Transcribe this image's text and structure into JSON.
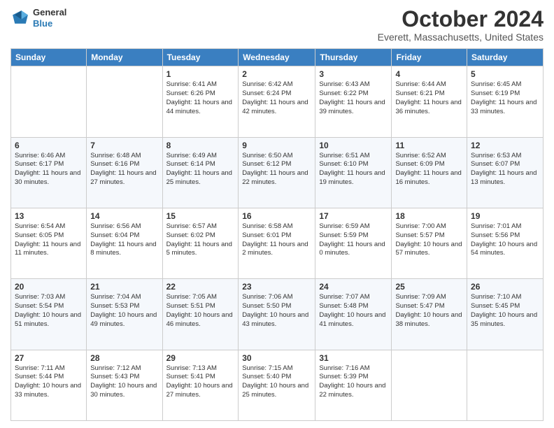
{
  "header": {
    "logo": {
      "general": "General",
      "blue": "Blue"
    },
    "title": "October 2024",
    "subtitle": "Everett, Massachusetts, United States"
  },
  "days_of_week": [
    "Sunday",
    "Monday",
    "Tuesday",
    "Wednesday",
    "Thursday",
    "Friday",
    "Saturday"
  ],
  "weeks": [
    [
      {
        "day": "",
        "info": ""
      },
      {
        "day": "",
        "info": ""
      },
      {
        "day": "1",
        "info": "Sunrise: 6:41 AM\nSunset: 6:26 PM\nDaylight: 11 hours and 44 minutes."
      },
      {
        "day": "2",
        "info": "Sunrise: 6:42 AM\nSunset: 6:24 PM\nDaylight: 11 hours and 42 minutes."
      },
      {
        "day": "3",
        "info": "Sunrise: 6:43 AM\nSunset: 6:22 PM\nDaylight: 11 hours and 39 minutes."
      },
      {
        "day": "4",
        "info": "Sunrise: 6:44 AM\nSunset: 6:21 PM\nDaylight: 11 hours and 36 minutes."
      },
      {
        "day": "5",
        "info": "Sunrise: 6:45 AM\nSunset: 6:19 PM\nDaylight: 11 hours and 33 minutes."
      }
    ],
    [
      {
        "day": "6",
        "info": "Sunrise: 6:46 AM\nSunset: 6:17 PM\nDaylight: 11 hours and 30 minutes."
      },
      {
        "day": "7",
        "info": "Sunrise: 6:48 AM\nSunset: 6:16 PM\nDaylight: 11 hours and 27 minutes."
      },
      {
        "day": "8",
        "info": "Sunrise: 6:49 AM\nSunset: 6:14 PM\nDaylight: 11 hours and 25 minutes."
      },
      {
        "day": "9",
        "info": "Sunrise: 6:50 AM\nSunset: 6:12 PM\nDaylight: 11 hours and 22 minutes."
      },
      {
        "day": "10",
        "info": "Sunrise: 6:51 AM\nSunset: 6:10 PM\nDaylight: 11 hours and 19 minutes."
      },
      {
        "day": "11",
        "info": "Sunrise: 6:52 AM\nSunset: 6:09 PM\nDaylight: 11 hours and 16 minutes."
      },
      {
        "day": "12",
        "info": "Sunrise: 6:53 AM\nSunset: 6:07 PM\nDaylight: 11 hours and 13 minutes."
      }
    ],
    [
      {
        "day": "13",
        "info": "Sunrise: 6:54 AM\nSunset: 6:05 PM\nDaylight: 11 hours and 11 minutes."
      },
      {
        "day": "14",
        "info": "Sunrise: 6:56 AM\nSunset: 6:04 PM\nDaylight: 11 hours and 8 minutes."
      },
      {
        "day": "15",
        "info": "Sunrise: 6:57 AM\nSunset: 6:02 PM\nDaylight: 11 hours and 5 minutes."
      },
      {
        "day": "16",
        "info": "Sunrise: 6:58 AM\nSunset: 6:01 PM\nDaylight: 11 hours and 2 minutes."
      },
      {
        "day": "17",
        "info": "Sunrise: 6:59 AM\nSunset: 5:59 PM\nDaylight: 11 hours and 0 minutes."
      },
      {
        "day": "18",
        "info": "Sunrise: 7:00 AM\nSunset: 5:57 PM\nDaylight: 10 hours and 57 minutes."
      },
      {
        "day": "19",
        "info": "Sunrise: 7:01 AM\nSunset: 5:56 PM\nDaylight: 10 hours and 54 minutes."
      }
    ],
    [
      {
        "day": "20",
        "info": "Sunrise: 7:03 AM\nSunset: 5:54 PM\nDaylight: 10 hours and 51 minutes."
      },
      {
        "day": "21",
        "info": "Sunrise: 7:04 AM\nSunset: 5:53 PM\nDaylight: 10 hours and 49 minutes."
      },
      {
        "day": "22",
        "info": "Sunrise: 7:05 AM\nSunset: 5:51 PM\nDaylight: 10 hours and 46 minutes."
      },
      {
        "day": "23",
        "info": "Sunrise: 7:06 AM\nSunset: 5:50 PM\nDaylight: 10 hours and 43 minutes."
      },
      {
        "day": "24",
        "info": "Sunrise: 7:07 AM\nSunset: 5:48 PM\nDaylight: 10 hours and 41 minutes."
      },
      {
        "day": "25",
        "info": "Sunrise: 7:09 AM\nSunset: 5:47 PM\nDaylight: 10 hours and 38 minutes."
      },
      {
        "day": "26",
        "info": "Sunrise: 7:10 AM\nSunset: 5:45 PM\nDaylight: 10 hours and 35 minutes."
      }
    ],
    [
      {
        "day": "27",
        "info": "Sunrise: 7:11 AM\nSunset: 5:44 PM\nDaylight: 10 hours and 33 minutes."
      },
      {
        "day": "28",
        "info": "Sunrise: 7:12 AM\nSunset: 5:43 PM\nDaylight: 10 hours and 30 minutes."
      },
      {
        "day": "29",
        "info": "Sunrise: 7:13 AM\nSunset: 5:41 PM\nDaylight: 10 hours and 27 minutes."
      },
      {
        "day": "30",
        "info": "Sunrise: 7:15 AM\nSunset: 5:40 PM\nDaylight: 10 hours and 25 minutes."
      },
      {
        "day": "31",
        "info": "Sunrise: 7:16 AM\nSunset: 5:39 PM\nDaylight: 10 hours and 22 minutes."
      },
      {
        "day": "",
        "info": ""
      },
      {
        "day": "",
        "info": ""
      }
    ]
  ]
}
